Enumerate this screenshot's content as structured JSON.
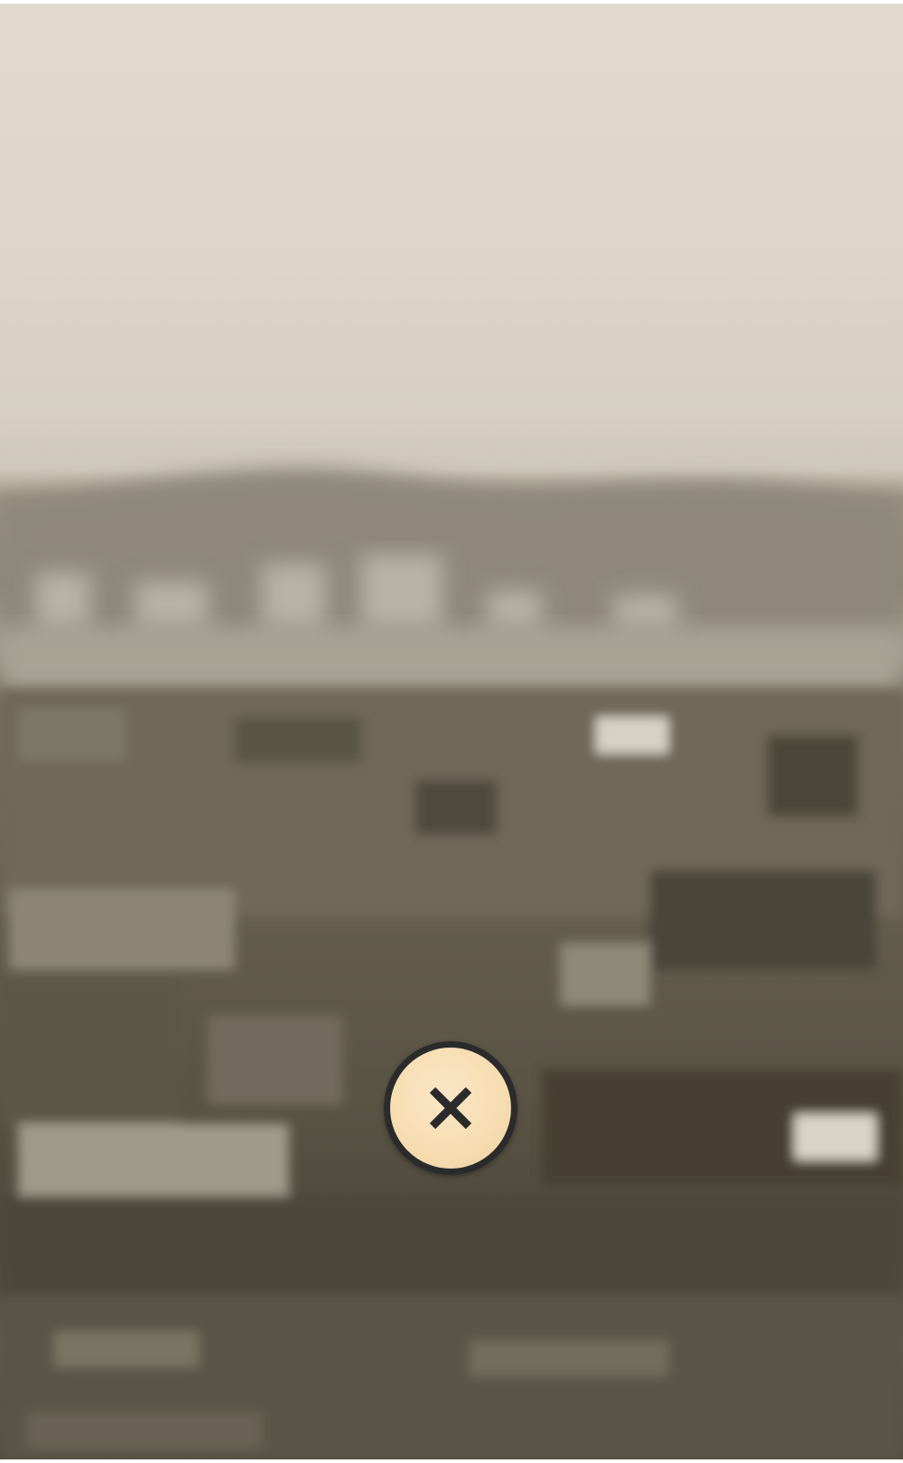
{
  "viewer": {
    "backdrop_icon": "blurred-sepia-city-photo",
    "close_button": {
      "icon": "close-icon",
      "icon_color": "#2b2b2b",
      "fill_color": "#f6dcb0"
    }
  }
}
